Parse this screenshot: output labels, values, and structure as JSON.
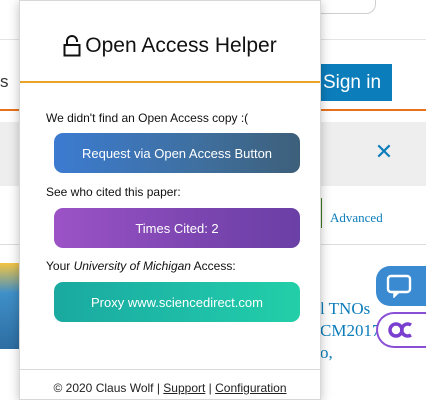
{
  "background": {
    "left_fragment": "s",
    "signin_label": "Sign in",
    "close_glyph": "✕",
    "advanced_label": "Advanced",
    "article_lines": [
      "l TNOs",
      "CM2017",
      "o,"
    ]
  },
  "popup": {
    "title": "Open Access Helper",
    "not_found_text": "We didn't find an Open Access copy :(",
    "request_button": "Request via Open Access Button",
    "cited_text": "See who cited this paper:",
    "times_cited_button": "Times Cited: 2",
    "access_prefix": "Your ",
    "access_institution": "University of Michigan",
    "access_suffix": " Access:",
    "proxy_button": "Proxy www.sciencedirect.com",
    "footer": {
      "copyright": "© 2020 Claus Wolf",
      "separator": " | ",
      "support_link": "Support",
      "configuration_link": "Configuration"
    }
  },
  "colors": {
    "accent_orange": "#e9711c",
    "sign_in_blue": "#0c7dbb",
    "request_gradient": [
      "#3b7bd0",
      "#3d5f7a"
    ],
    "cited_gradient": [
      "#9b53c6",
      "#6a3fa6"
    ],
    "proxy_gradient": [
      "#1aa9a0",
      "#22cfa8"
    ]
  },
  "icons": {
    "title_icon": "lock-open-icon",
    "chat_icon": "chat-bubble-icon",
    "oc_icon": "oc-logo-icon",
    "close_icon": "close-icon"
  }
}
